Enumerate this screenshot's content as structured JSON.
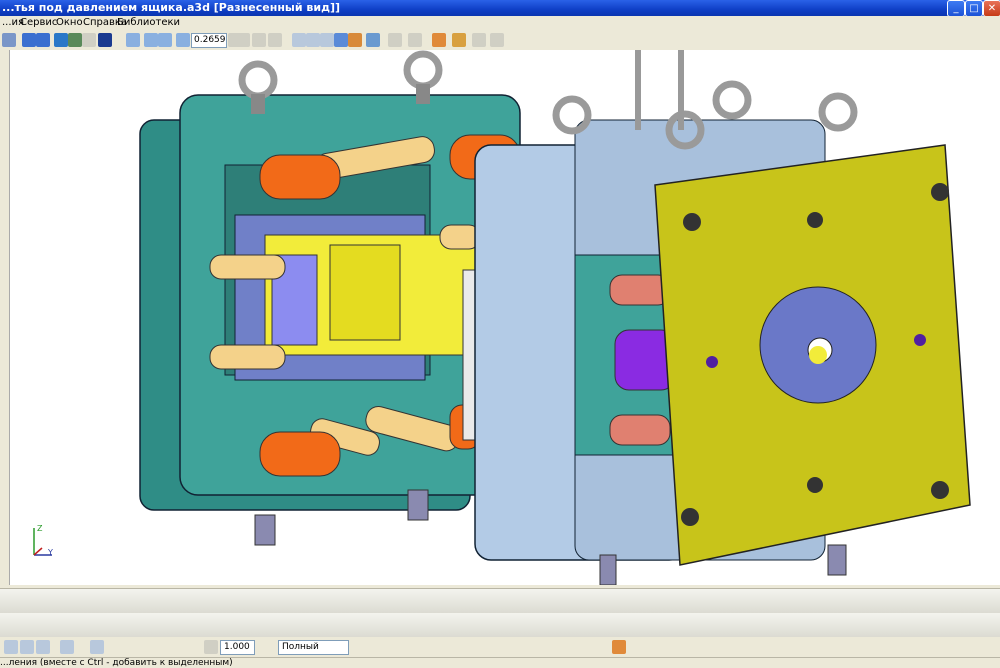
{
  "window": {
    "title": "...тья под давлением ящика.a3d [Разнесенный вид]]",
    "btn_minimize": "_",
    "btn_maximize": "□",
    "btn_close": "✕"
  },
  "menu": {
    "items": [
      "...ия",
      "Сервис",
      "Окно",
      "Справка",
      "Библиотеки"
    ]
  },
  "toolbar": {
    "zoom_value": "0.2659"
  },
  "axes": {
    "z_label": "Z",
    "y_label": "Y"
  },
  "bottom_toolbar": {
    "scale_value": "1.000",
    "line_style": "Полный"
  },
  "status": {
    "text": "...ления (вместе с Ctrl - добавить к выделенным)"
  },
  "colors": {
    "titlebar": "#0f3fc6",
    "chrome": "#ece9d8",
    "mold_teal": "#3d9c94",
    "mold_lightblue": "#b3cbe6",
    "plate_olive": "#c8c41a",
    "part_yellow": "#f2ec3a",
    "pin_orange": "#f26a18",
    "core_purple": "#8a2be2"
  }
}
